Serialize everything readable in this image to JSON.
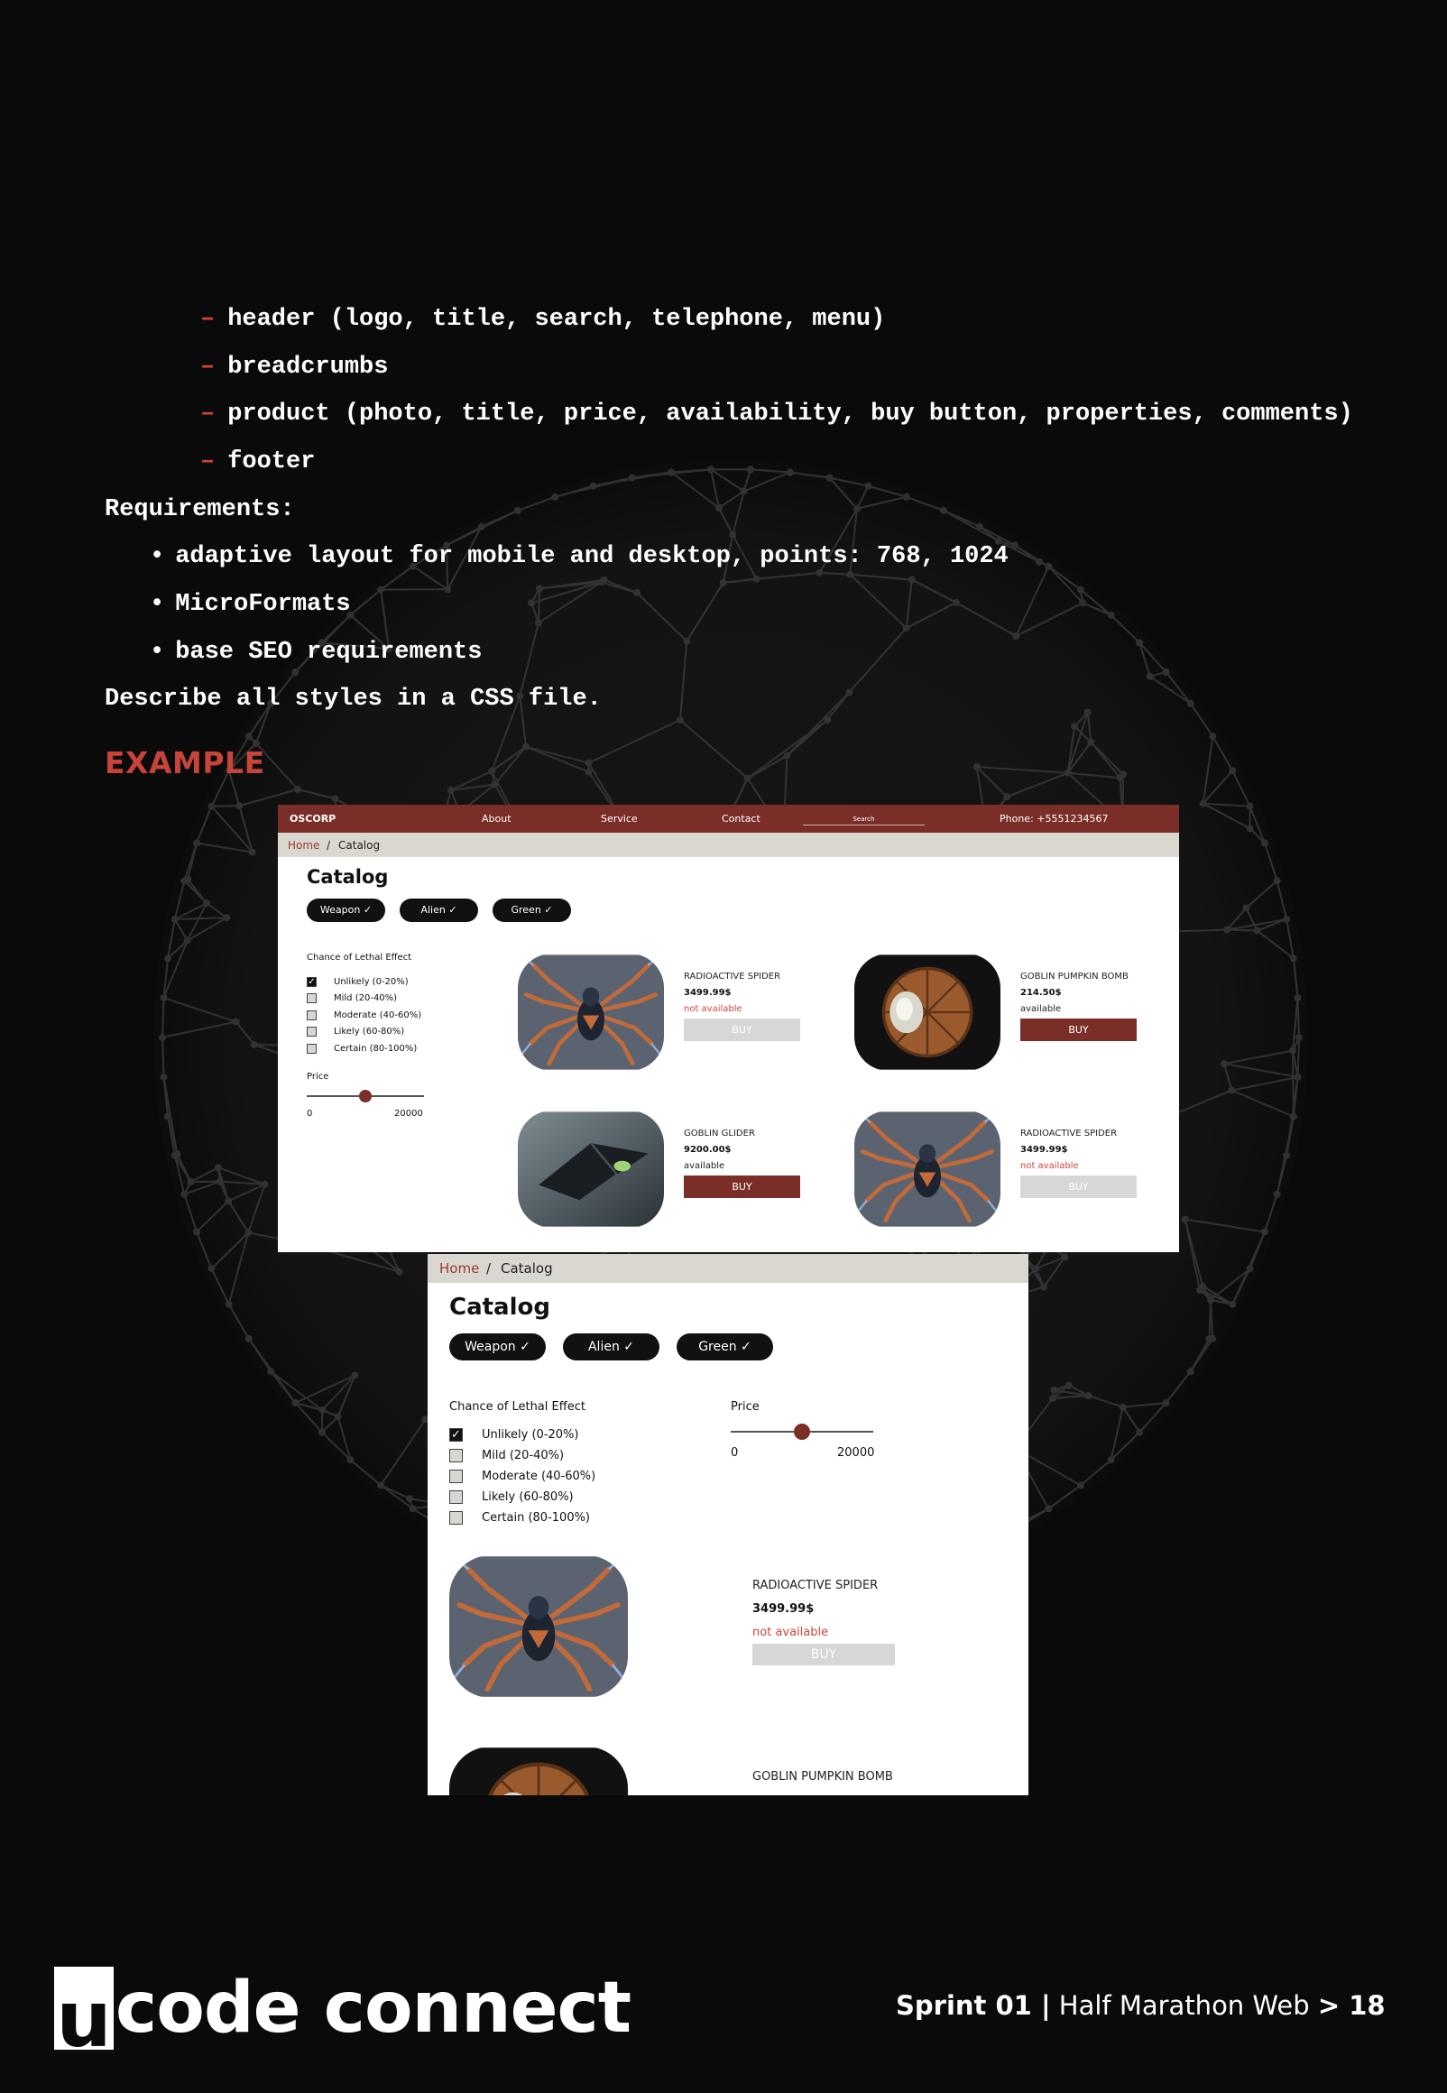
{
  "structure_items": [
    "header (logo, title, search, telephone, menu)",
    "breadcrumbs",
    "product (photo, title, price, availability, buy button, properties, comments)",
    "footer"
  ],
  "dash_char": "–",
  "requirements_label": "Requirements:",
  "requirements": [
    "adaptive layout for mobile and desktop, points: 768, 1024",
    "MicroFormats",
    "base SEO requirements"
  ],
  "bullet_char": "•",
  "styles_note": "Describe all styles in a CSS file.",
  "example_label": "EXAMPLE",
  "mock": {
    "logo": "OSCORP",
    "nav": [
      "About",
      "Service",
      "Contact"
    ],
    "search_placeholder": "Search",
    "phone": "Phone: +5551234567",
    "breadcrumb_home": "Home",
    "breadcrumb_sep": "/",
    "breadcrumb_current": "Catalog",
    "catalog_title": "Catalog",
    "chips": [
      "Weapon ✓",
      "Alien ✓",
      "Green ✓"
    ],
    "filter_title": "Chance of Lethal Effect",
    "filter_options": [
      "Unlikely (0-20%)",
      "Mild (20-40%)",
      "Moderate (40-60%)",
      "Likely (60-80%)",
      "Certain (80-100%)"
    ],
    "filter_checked_index": 0,
    "check_mark": "✓",
    "price_label": "Price",
    "price_min": "0",
    "price_max": "20000",
    "price_slider_fraction": 0.5,
    "buy_label": "BUY",
    "products": [
      {
        "name": "RADIOACTIVE SPIDER",
        "price": "3499.99$",
        "availability": "not available",
        "available": false,
        "image": "spider"
      },
      {
        "name": "GOBLIN PUMPKIN BOMB",
        "price": "214.50$",
        "availability": "available",
        "available": true,
        "image": "bomb"
      },
      {
        "name": "GOBLIN GLIDER",
        "price": "9200.00$",
        "availability": "available",
        "available": true,
        "image": "glider"
      },
      {
        "name": "RADIOACTIVE SPIDER",
        "price": "3499.99$",
        "availability": "not available",
        "available": false,
        "image": "spider"
      }
    ]
  },
  "footer": {
    "brand_u": "u",
    "brand_rest": "code connect",
    "sprint_bold": "Sprint 01 |",
    "sprint_course": " Half Marathon Web ",
    "sprint_page": "> 18"
  },
  "colors": {
    "background": "#0a0a0a",
    "accent_red": "#d0453b",
    "mock_header": "#7b2e28",
    "breadcrumb_bg": "#d9d7d0"
  }
}
